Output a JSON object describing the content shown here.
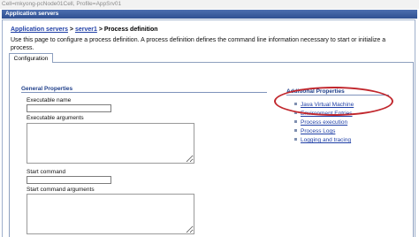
{
  "top_strip": {
    "text": "Cell=mkyong-pcNode01Cell, Profile=AppSrv01"
  },
  "title_bar": {
    "title": "Application servers"
  },
  "breadcrumb": {
    "link1": "Application servers",
    "sep1": " > ",
    "link2": "server1",
    "sep2": " > ",
    "current": "Process definition"
  },
  "description": "Use this page to configure a process definition. A process definition defines the command line information necessary to start or initialize a process.",
  "tabs": [
    {
      "label": "Configuration"
    }
  ],
  "general_properties": {
    "title": "General Properties",
    "fields": {
      "executable_name": {
        "label": "Executable name",
        "value": ""
      },
      "executable_arguments": {
        "label": "Executable arguments",
        "value": ""
      },
      "start_command": {
        "label": "Start command",
        "value": ""
      },
      "start_command_arguments": {
        "label": "Start command arguments",
        "value": ""
      }
    }
  },
  "additional_properties": {
    "title": "Additional Properties",
    "items": [
      {
        "label": "Java Virtual Machine"
      },
      {
        "label": "Environment Entries"
      },
      {
        "label": "Process execution"
      },
      {
        "label": "Process Logs"
      },
      {
        "label": "Logging and tracing"
      }
    ]
  },
  "colors": {
    "highlight": "#c1272d",
    "link": "#1f3fa6",
    "title_bar": "#3a5ca0"
  }
}
